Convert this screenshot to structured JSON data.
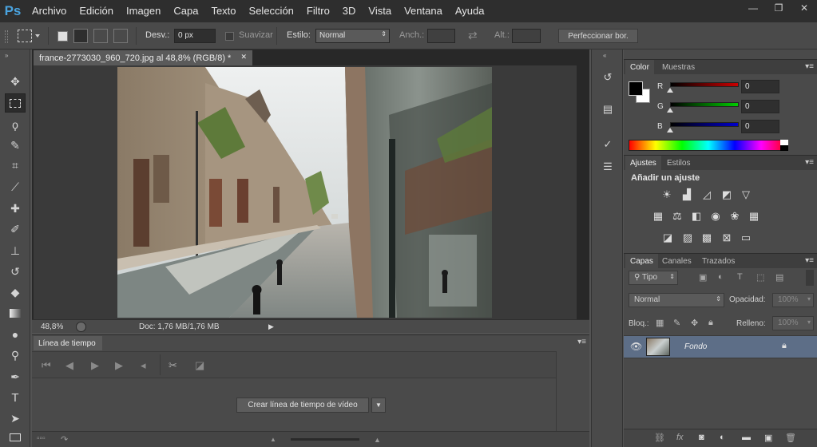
{
  "app": {
    "logo": "Ps"
  },
  "menu": [
    "Archivo",
    "Edición",
    "Imagen",
    "Capa",
    "Texto",
    "Selección",
    "Filtro",
    "3D",
    "Vista",
    "Ventana",
    "Ayuda"
  ],
  "window_controls": {
    "minimize": "—",
    "restore": "❐",
    "close": "✕"
  },
  "options": {
    "feather_label": "Desv.:",
    "feather_value": "0 px",
    "antialias_label": "Suavizar",
    "style_label": "Estilo:",
    "style_value": "Normal",
    "width_label": "Anch.:",
    "height_label": "Alt.:",
    "refine_button": "Perfeccionar bor."
  },
  "document": {
    "tab_title": "france-2773030_960_720.jpg al 48,8% (RGB/8) *",
    "close": "✕",
    "zoom": "48,8%",
    "doc_info": "Doc: 1,76 MB/1,76 MB"
  },
  "timeline": {
    "tab": "Línea de tiempo",
    "create_button": "Crear línea de tiempo de vídeo"
  },
  "panels": {
    "color_tab": "Color",
    "swatches_tab": "Muestras",
    "rgb": [
      {
        "label": "R",
        "value": "0"
      },
      {
        "label": "G",
        "value": "0"
      },
      {
        "label": "B",
        "value": "0"
      }
    ],
    "adjustments_tab": "Ajustes",
    "styles_tab": "Estilos",
    "add_adjustment": "Añadir un ajuste",
    "layers_tab": "Capas",
    "channels_tab": "Canales",
    "paths_tab": "Trazados",
    "filter_kind": "Tipo",
    "blend_mode": "Normal",
    "opacity_label": "Opacidad:",
    "opacity_value": "100%",
    "lock_label": "Bloq.:",
    "fill_label": "Relleno:",
    "fill_value": "100%",
    "layer_name": "Fondo"
  },
  "colors": {
    "accent": "#4aa3df",
    "layer_selected": "#5d6e87",
    "red_slider": "#cc0000",
    "green_slider": "#00cc00",
    "blue_slider": "#0000cc"
  }
}
